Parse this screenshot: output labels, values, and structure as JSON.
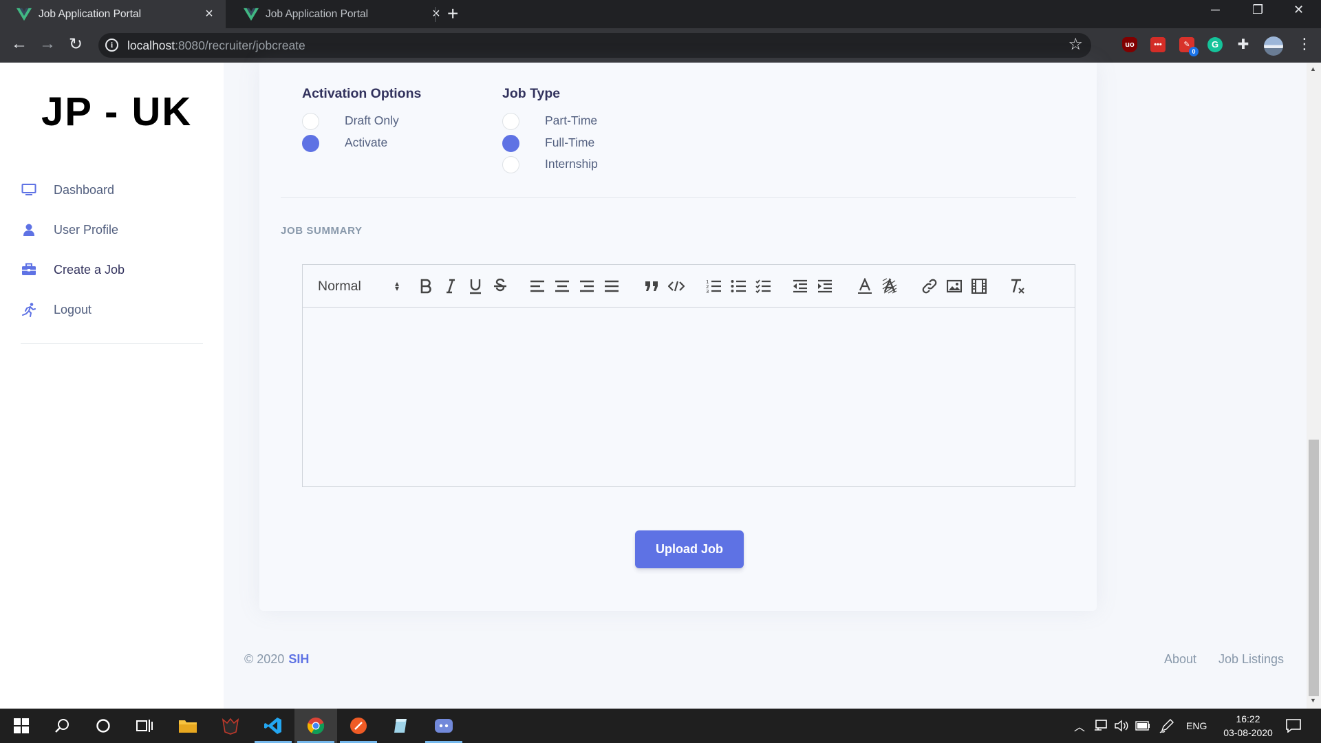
{
  "browser": {
    "tabs": [
      {
        "title": "Job Application Portal",
        "active": true
      },
      {
        "title": "Job Application Portal",
        "active": false
      }
    ],
    "new_tab": "+",
    "url_host": "localhost",
    "url_path": ":8080/recruiter/jobcreate",
    "window_controls": {
      "minimize": "─",
      "restore": "❐",
      "close": "✕"
    },
    "extensions": [
      {
        "name": "ublock-origin",
        "text": "uo",
        "color": "#800000"
      },
      {
        "name": "lastpass",
        "text": "•••",
        "color": "#d32d27"
      },
      {
        "name": "red-extension",
        "text": "",
        "badge": "0",
        "color": "#d8322b"
      },
      {
        "name": "grammarly",
        "text": "G",
        "color": "#15c39a"
      }
    ]
  },
  "sidebar": {
    "brand": "JP - UK",
    "items": [
      {
        "label": "Dashboard",
        "icon": "monitor-icon"
      },
      {
        "label": "User Profile",
        "icon": "user-icon"
      },
      {
        "label": "Create a Job",
        "icon": "briefcase-icon"
      },
      {
        "label": "Logout",
        "icon": "running-person-icon"
      }
    ]
  },
  "form": {
    "activation": {
      "title": "Activation Options",
      "options": [
        "Draft Only",
        "Activate"
      ],
      "selected": "Activate"
    },
    "job_type": {
      "title": "Job Type",
      "options": [
        "Part-Time",
        "Full-Time",
        "Internship"
      ],
      "selected": "Full-Time"
    },
    "summary_label": "JOB SUMMARY",
    "editor": {
      "format_select": "Normal",
      "body": ""
    },
    "upload_button": "Upload Job"
  },
  "footer": {
    "copyright": "© 2020",
    "org": "SIH",
    "links": [
      "About",
      "Job Listings"
    ]
  },
  "taskbar": {
    "time": "16:22",
    "date": "03-08-2020",
    "language": "ENG"
  },
  "colors": {
    "primary": "#5e72e4",
    "chrome_dark": "#202124",
    "sidebar_bg": "#ffffff",
    "page_bg": "#f5f7fb"
  }
}
